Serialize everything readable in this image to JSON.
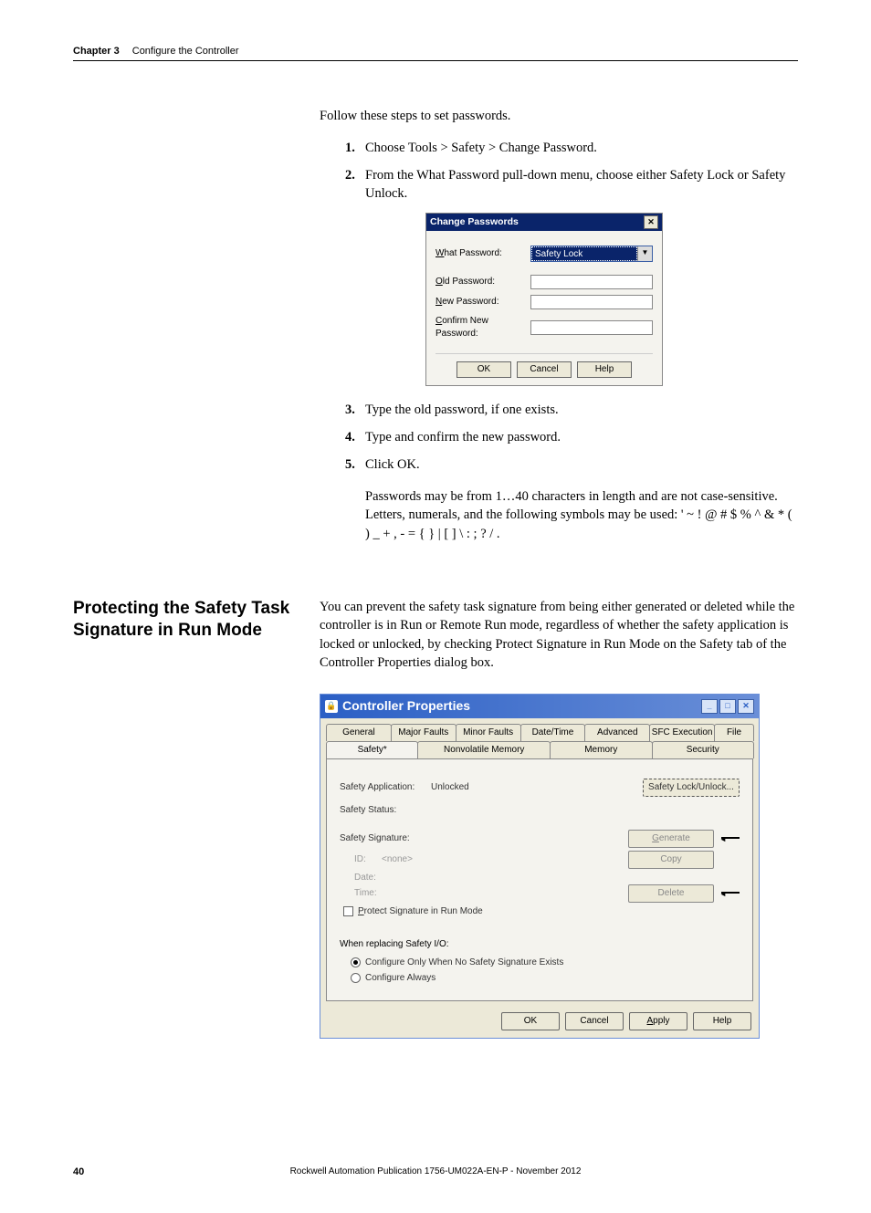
{
  "header": {
    "chapter": "Chapter 3",
    "title": "Configure the Controller"
  },
  "intro": "Follow these steps to set passwords.",
  "steps": {
    "s1": {
      "num": "1.",
      "text": "Choose Tools > Safety > Change Password."
    },
    "s2": {
      "num": "2.",
      "text": "From the What Password pull-down menu, choose either Safety Lock or Safety Unlock."
    },
    "s3": {
      "num": "3.",
      "text": "Type the old password, if one exists."
    },
    "s4": {
      "num": "4.",
      "text": "Type and confirm the new password."
    },
    "s5": {
      "num": "5.",
      "text": "Click OK."
    }
  },
  "note": "Passwords may be from 1…40 characters in length and are not case-sensitive. Letters, numerals, and the following symbols may be used: ' ~ ! @ # $ % ^ & * ( ) _ + , - = { } | [ ] \\ : ; ? / .",
  "dialog1": {
    "title": "Change Passwords",
    "what_label": "What Password:",
    "what_value": "Safety Lock",
    "old_label": "Old Password:",
    "new_label": "New Password:",
    "confirm_label": "Confirm New Password:",
    "ok": "OK",
    "cancel": "Cancel",
    "help": "Help"
  },
  "section": {
    "heading": "Protecting the Safety Task Signature in Run Mode",
    "body": "You can prevent the safety task signature from being either generated or deleted while the controller is in Run or Remote Run mode, regardless of whether the safety application is locked or unlocked, by checking Protect Signature in Run Mode on the Safety tab of the Controller Properties dialog box."
  },
  "dialog2": {
    "title": "Controller Properties",
    "tabs_row1": [
      "General",
      "Major Faults",
      "Minor Faults",
      "Date/Time",
      "Advanced",
      "SFC Execution",
      "File"
    ],
    "tabs_row2": [
      "Safety*",
      "Nonvolatile Memory",
      "Memory",
      "Security"
    ],
    "safety_app_label": "Safety Application:",
    "safety_app_value": "Unlocked",
    "safety_status_label": "Safety Status:",
    "safety_sig_label": "Safety Signature:",
    "id_label": "ID:",
    "id_value": "<none>",
    "date_label": "Date:",
    "time_label": "Time:",
    "protect_label": "Protect Signature in Run Mode",
    "lock_btn": "Safety Lock/Unlock...",
    "generate_btn": "Generate",
    "copy_btn": "Copy",
    "delete_btn": "Delete",
    "replace_hdr": "When replacing Safety I/O:",
    "opt1": "Configure Only When No Safety Signature Exists",
    "opt2": "Configure Always",
    "ok": "OK",
    "cancel": "Cancel",
    "apply": "Apply",
    "help": "Help"
  },
  "footer": {
    "page": "40",
    "pub": "Rockwell Automation Publication 1756-UM022A-EN-P - November 2012"
  }
}
